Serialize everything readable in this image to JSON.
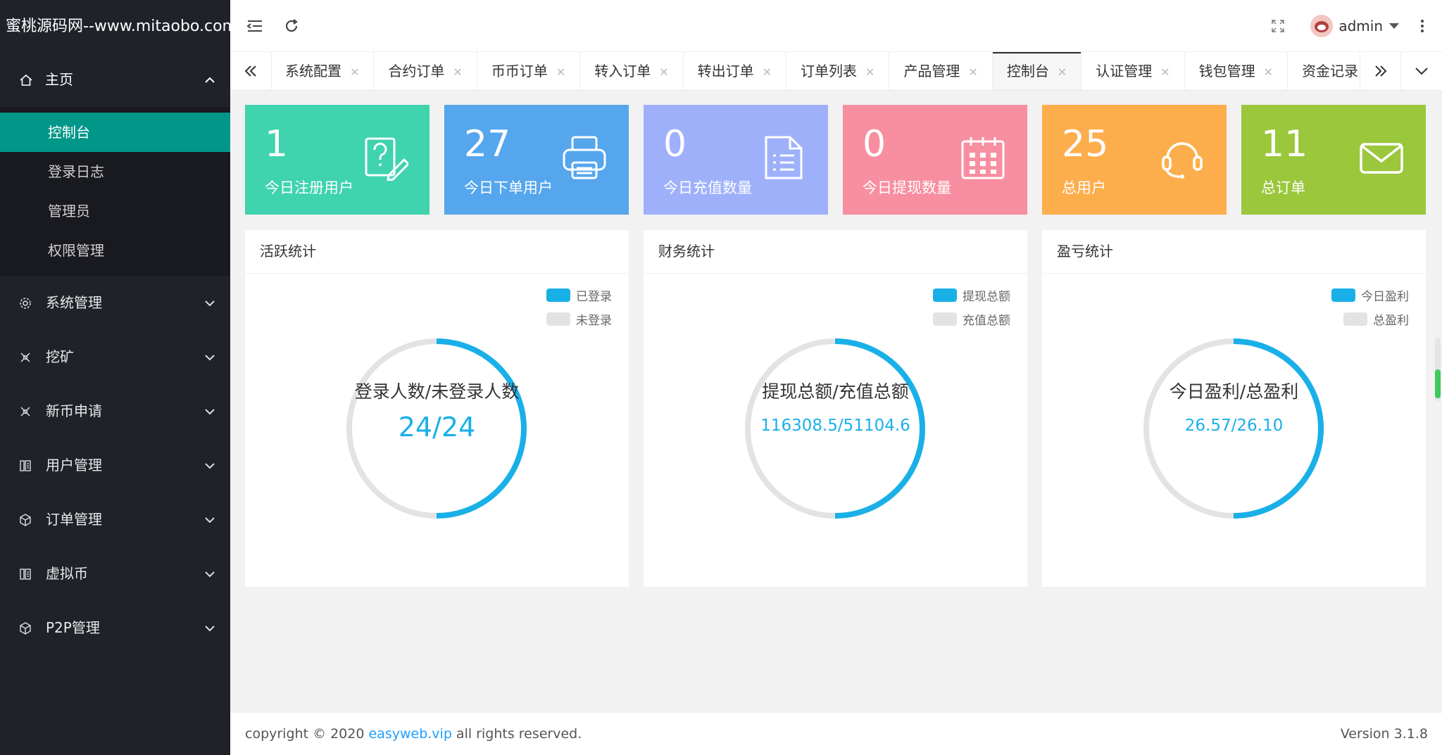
{
  "sidebar": {
    "logo": "蜜桃源码网--www.mitaobo.com",
    "home": {
      "label": "主页",
      "icon": "home-icon",
      "sub_items": [
        {
          "label": "控制台",
          "active": true
        },
        {
          "label": "登录日志"
        },
        {
          "label": "管理员"
        },
        {
          "label": "权限管理"
        }
      ]
    },
    "menu": [
      {
        "label": "系统管理",
        "icon": "gear-icon"
      },
      {
        "label": "挖矿",
        "icon": "pickaxe-icon"
      },
      {
        "label": "新币申请",
        "icon": "coin-apply-icon"
      },
      {
        "label": "用户管理",
        "icon": "users-icon"
      },
      {
        "label": "订单管理",
        "icon": "box-icon"
      },
      {
        "label": "虚拟币",
        "icon": "coin-icon"
      },
      {
        "label": "P2P管理",
        "icon": "p2p-icon"
      }
    ]
  },
  "header": {
    "username": "admin"
  },
  "tabs": [
    {
      "label": "系统配置"
    },
    {
      "label": "合约订单"
    },
    {
      "label": "币币订单"
    },
    {
      "label": "转入订单"
    },
    {
      "label": "转出订单"
    },
    {
      "label": "订单列表"
    },
    {
      "label": "产品管理"
    },
    {
      "label": "控制台",
      "active": true
    },
    {
      "label": "认证管理"
    },
    {
      "label": "钱包管理"
    },
    {
      "label": "资金记录"
    }
  ],
  "stats": [
    {
      "value": "1",
      "label": "今日注册用户",
      "color": "#3fd3ae",
      "icon": "question-edit-icon"
    },
    {
      "value": "27",
      "label": "今日下单用户",
      "color": "#55a6ec",
      "icon": "printer-icon"
    },
    {
      "value": "0",
      "label": "今日充值数量",
      "color": "#9fb0fb",
      "icon": "document-list-icon"
    },
    {
      "value": "0",
      "label": "今日提现数量",
      "color": "#f78fa1",
      "icon": "calendar-icon"
    },
    {
      "value": "25",
      "label": "总用户",
      "color": "#fdae4c",
      "icon": "headset-icon"
    },
    {
      "value": "11",
      "label": "总订单",
      "color": "#9ac73c",
      "icon": "mail-icon"
    }
  ],
  "panels": [
    {
      "title": "活跃统计",
      "legend": [
        "已登录",
        "未登录"
      ],
      "center_title": "登录人数/未登录人数",
      "center_value": "24/24",
      "fraction": 0.5
    },
    {
      "title": "财务统计",
      "legend": [
        "提现总额",
        "充值总额"
      ],
      "center_title": "提现总额/充值总额",
      "center_value": "116308.5/51104.6",
      "fraction": 0.5
    },
    {
      "title": "盈亏统计",
      "legend": [
        "今日盈利",
        "总盈利"
      ],
      "center_title": "今日盈利/总盈利",
      "center_value": "26.57/26.10",
      "fraction": 0.5
    }
  ],
  "colors": {
    "accent_teal": "#009688",
    "donut_primary": "#19b0e8",
    "donut_secondary": "#e3e3e3"
  },
  "footer": {
    "copyright_prefix": "copyright © 2020 ",
    "link_text": "easyweb.vip",
    "copyright_suffix": " all rights reserved.",
    "version": "Version 3.1.8"
  }
}
